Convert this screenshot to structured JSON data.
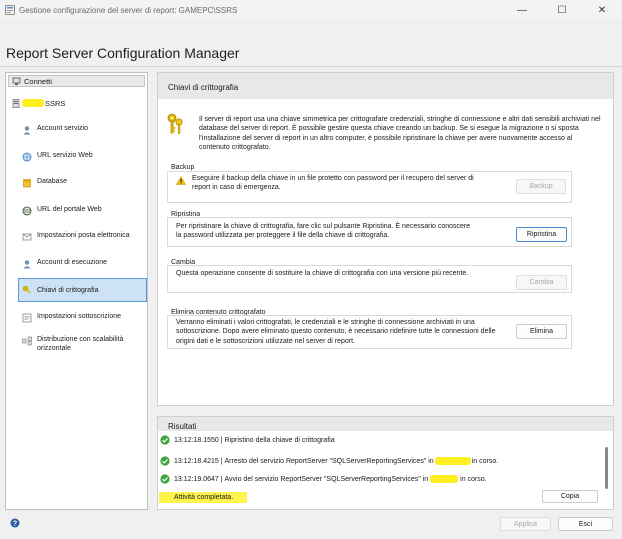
{
  "window": {
    "title": "Gestione configurazione del server di report: GAMEPC\\SSRS",
    "controls": {
      "minimize": "—",
      "maximize": "☐",
      "close": "✕"
    }
  },
  "header": {
    "title": "Report Server Configuration Manager"
  },
  "sidebar": {
    "connect_label": "Connetti",
    "server_suffix": "SSRS",
    "items": [
      {
        "label": "Account servizio",
        "icon": "service-account-icon"
      },
      {
        "label": "URL servizio Web",
        "icon": "web-service-url-icon"
      },
      {
        "label": "Database",
        "icon": "database-icon"
      },
      {
        "label": "URL del portale Web",
        "icon": "web-portal-url-icon"
      },
      {
        "label": "Impostazioni posta elettronica",
        "icon": "email-settings-icon"
      },
      {
        "label": "Account di esecuzione",
        "icon": "execution-account-icon"
      },
      {
        "label": "Chiavi di crittografia",
        "icon": "encryption-keys-icon",
        "selected": true
      },
      {
        "label": "Impostazioni sottoscrizione",
        "icon": "subscription-settings-icon"
      },
      {
        "label": "Distribuzione con scalabilità orizzontale",
        "icon": "scale-out-icon"
      }
    ]
  },
  "main": {
    "title": "Chiavi di crittografia",
    "intro": "Il server di report usa una chiave simmetrica per crittografare credenziali, stringhe di connessione e altri dati sensibili archiviati nel database del server di report. È possibile gestire questa chiave creando un backup. Se si esegue la migrazione o si sposta l'installazione del server di report in un altro computer, è possibile ripristinare la chiave per avere nuovamente accesso al contenuto crittografato.",
    "backup": {
      "label": "Backup",
      "text": "Eseguire il backup della chiave in un file protetto con password per il recupero del server di report in caso di emergenza.",
      "button": "Backup"
    },
    "restore": {
      "label": "Ripristina",
      "text": "Per ripristinare la chiave di crittografia, fare clic sul pulsante Ripristina. È necessario conoscere la password utilizzata per proteggere il file della chiave di crittografia.",
      "button": "Ripristina"
    },
    "change": {
      "label": "Cambia",
      "text": "Questa operazione consente di sostituire la chiave di crittografia con una versione più recente.",
      "button": "Cambia"
    },
    "delete": {
      "label": "Elimina contenuto crittografato",
      "text": "Verranno eliminati i valori crittografati, le credenziali e le stringhe di connessione archiviati in una sottoscrizione. Dopo avere eliminato questo contenuto, è necessario ridefinire tutte le connessioni delle origini dati e le sottoscrizioni utilizzate nel server di report.",
      "button": "Elimina"
    }
  },
  "results": {
    "title": "Risultati",
    "rows": [
      {
        "time": "13:12:18.1550",
        "msg": "Ripristino della chiave di crittografia"
      },
      {
        "time": "13:12:18.4215",
        "msg": "Arresto del servizio ReportServer \"SQLServerReportingServices\" in",
        "msg_end": "in corso."
      },
      {
        "time": "13:12:19.0647",
        "msg": "Avvio del servizio ReportServer \"SQLServerReportingServices\" in",
        "msg_end": "in corso."
      }
    ],
    "status": "Attività completata.",
    "copy_button": "Copia"
  },
  "footer": {
    "apply_button": "Applica",
    "exit_button": "Esci"
  }
}
